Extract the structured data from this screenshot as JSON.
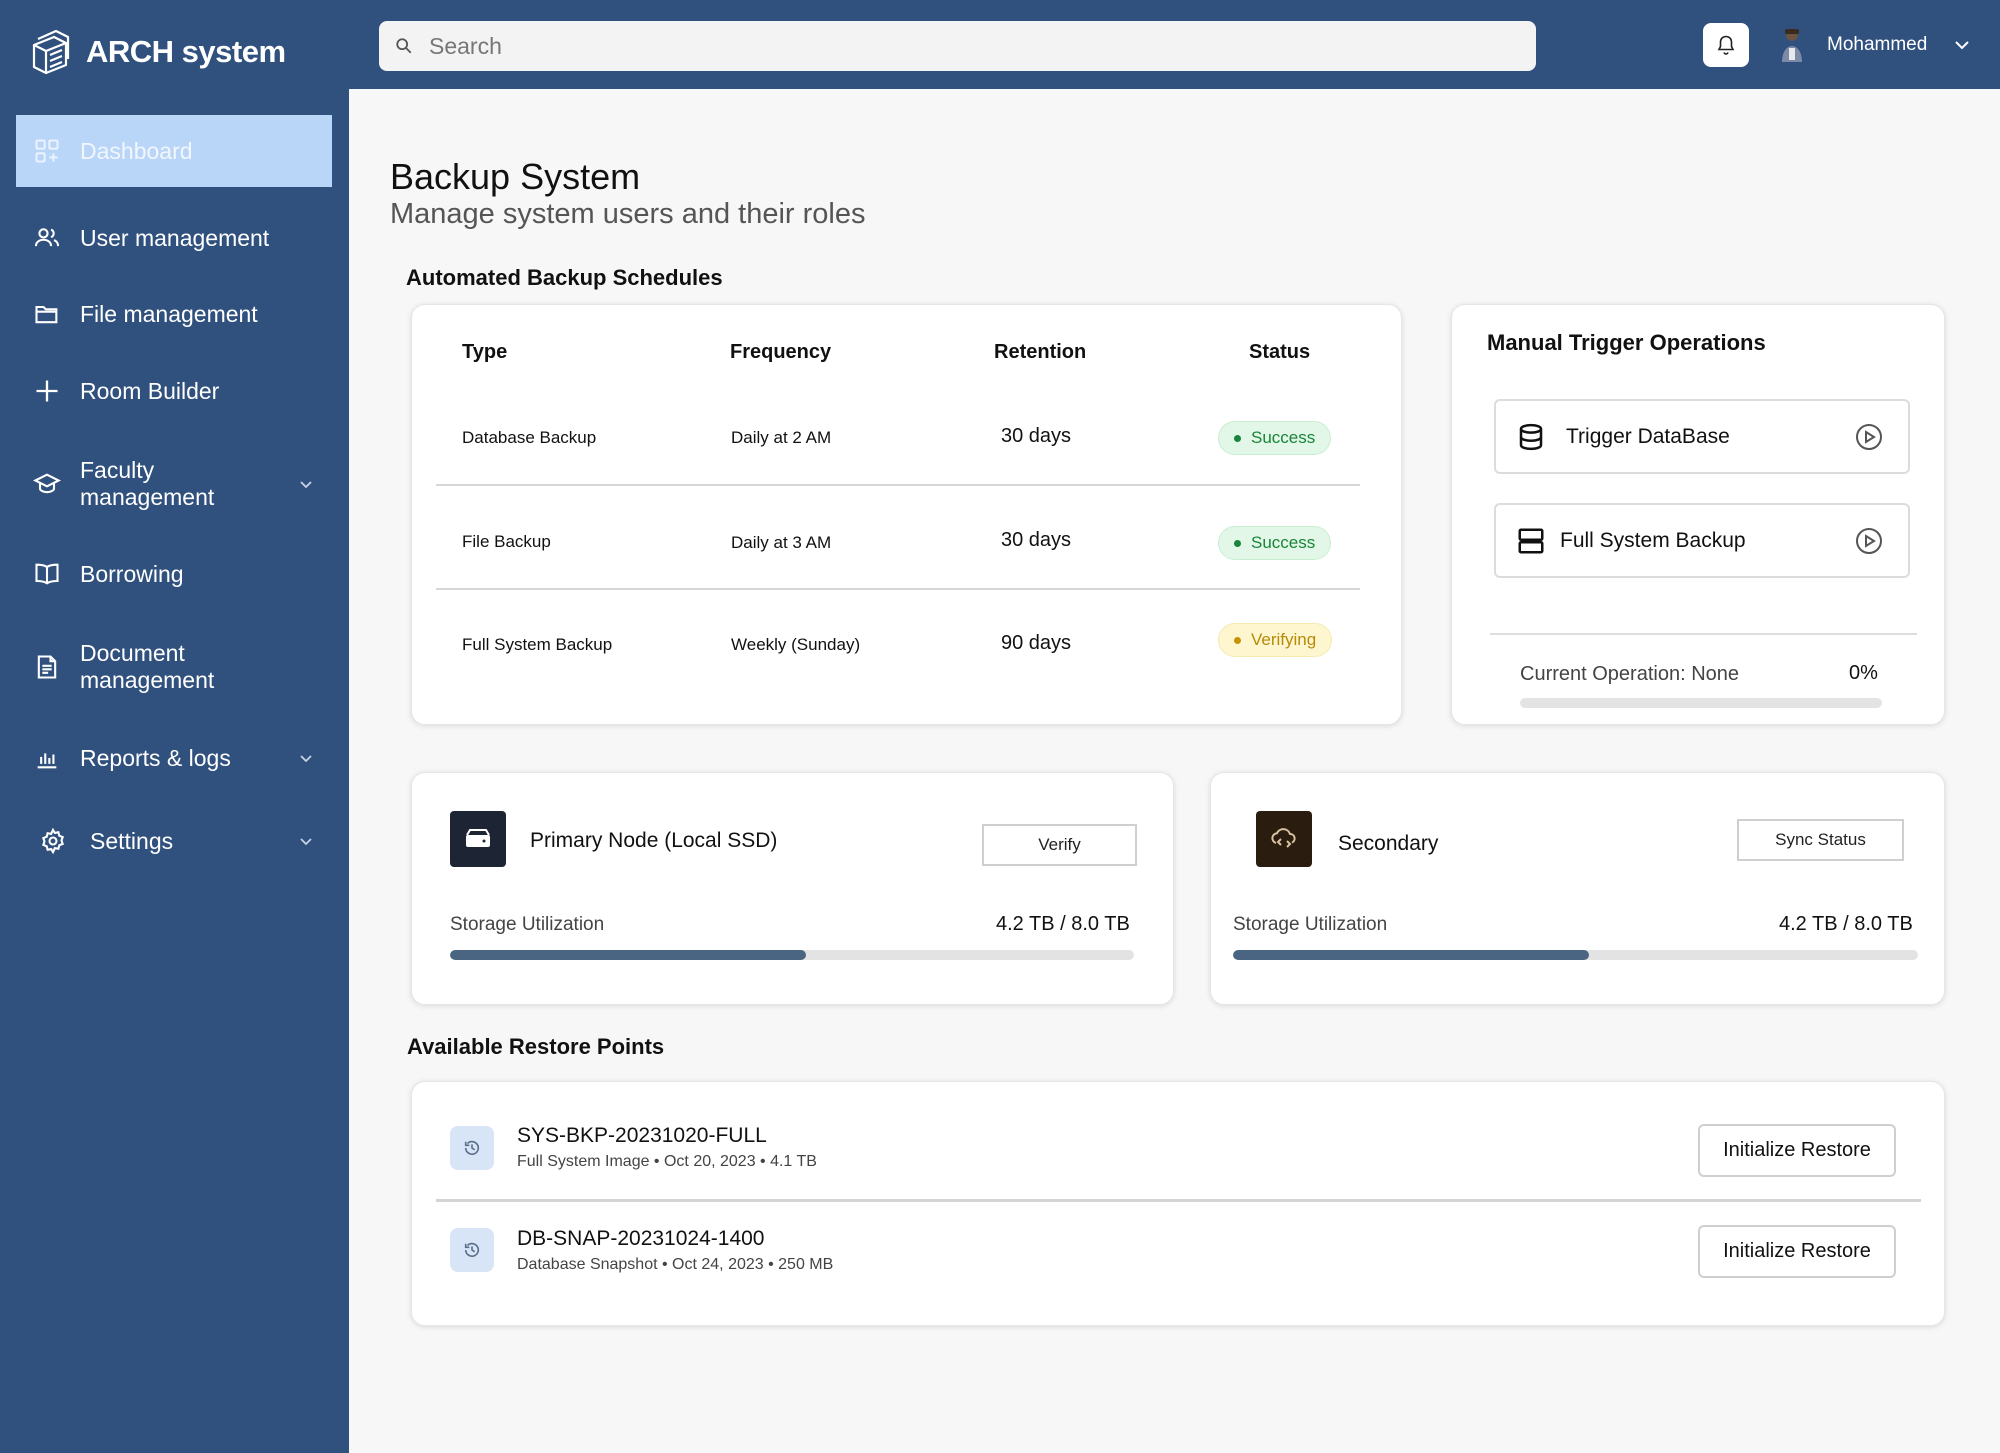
{
  "app": {
    "name": "ARCH system"
  },
  "sidebar": {
    "items": [
      {
        "label": "Dashboard",
        "icon": "dashboard-icon"
      },
      {
        "label": "User management",
        "icon": "users-icon"
      },
      {
        "label": "File management",
        "icon": "folder-icon"
      },
      {
        "label": "Room Builder",
        "icon": "plus-icon"
      },
      {
        "label": "Faculty management",
        "icon": "graduation-cap-icon"
      },
      {
        "label": "Borrowing",
        "icon": "book-icon"
      },
      {
        "label": "Document management",
        "icon": "document-icon"
      },
      {
        "label": "Reports & logs",
        "icon": "bar-chart-icon"
      },
      {
        "label": "Settings",
        "icon": "gear-icon"
      }
    ]
  },
  "header": {
    "search_placeholder": "Search",
    "user_name": "Mohammed"
  },
  "page": {
    "title": "Backup System",
    "subtitle": "Manage system users and their roles"
  },
  "schedules": {
    "title": "Automated Backup Schedules",
    "columns": [
      "Type",
      "Frequency",
      "Retention",
      "Status"
    ],
    "rows": [
      {
        "type": "Database Backup",
        "frequency": "Daily at 2 AM",
        "retention": "30 days",
        "status": "Success"
      },
      {
        "type": "File Backup",
        "frequency": "Daily at 3 AM",
        "retention": "30 days",
        "status": "Success"
      },
      {
        "type": "Full System Backup",
        "frequency": "Weekly (Sunday)",
        "retention": "90 days",
        "status": "Verifying"
      }
    ]
  },
  "manual": {
    "title": "Manual Trigger Operations",
    "trigger_db": "Trigger DataBase",
    "full_backup": "Full System Backup",
    "current_operation": "Current Operation: None",
    "progress_label": "0%",
    "progress": 0
  },
  "storage": {
    "primary": {
      "title": "Primary Node (Local SSD)",
      "button": "Verify",
      "util_label": "Storage Utilization",
      "util_value": "4.2 TB / 8.0 TB",
      "fraction": 0.52
    },
    "secondary": {
      "title": "Secondary",
      "button": "Sync Status",
      "util_label": "Storage Utilization",
      "util_value": "4.2 TB / 8.0 TB",
      "fraction": 0.52
    }
  },
  "restore": {
    "title": "Available Restore Points",
    "items": [
      {
        "name": "SYS-BKP-20231020-FULL",
        "meta": "Full System Image • Oct 20, 2023 • 4.1 TB",
        "button": "Initialize Restore"
      },
      {
        "name": "DB-SNAP-20231024-1400",
        "meta": "Database Snapshot • Oct 24, 2023 • 250 MB",
        "button": "Initialize Restore"
      }
    ]
  },
  "colors": {
    "sidebar": "#30507e",
    "active_nav": "#b9d5f7",
    "success": "#19853a",
    "verifying": "#c79408",
    "progress_fill": "#4a6582"
  }
}
